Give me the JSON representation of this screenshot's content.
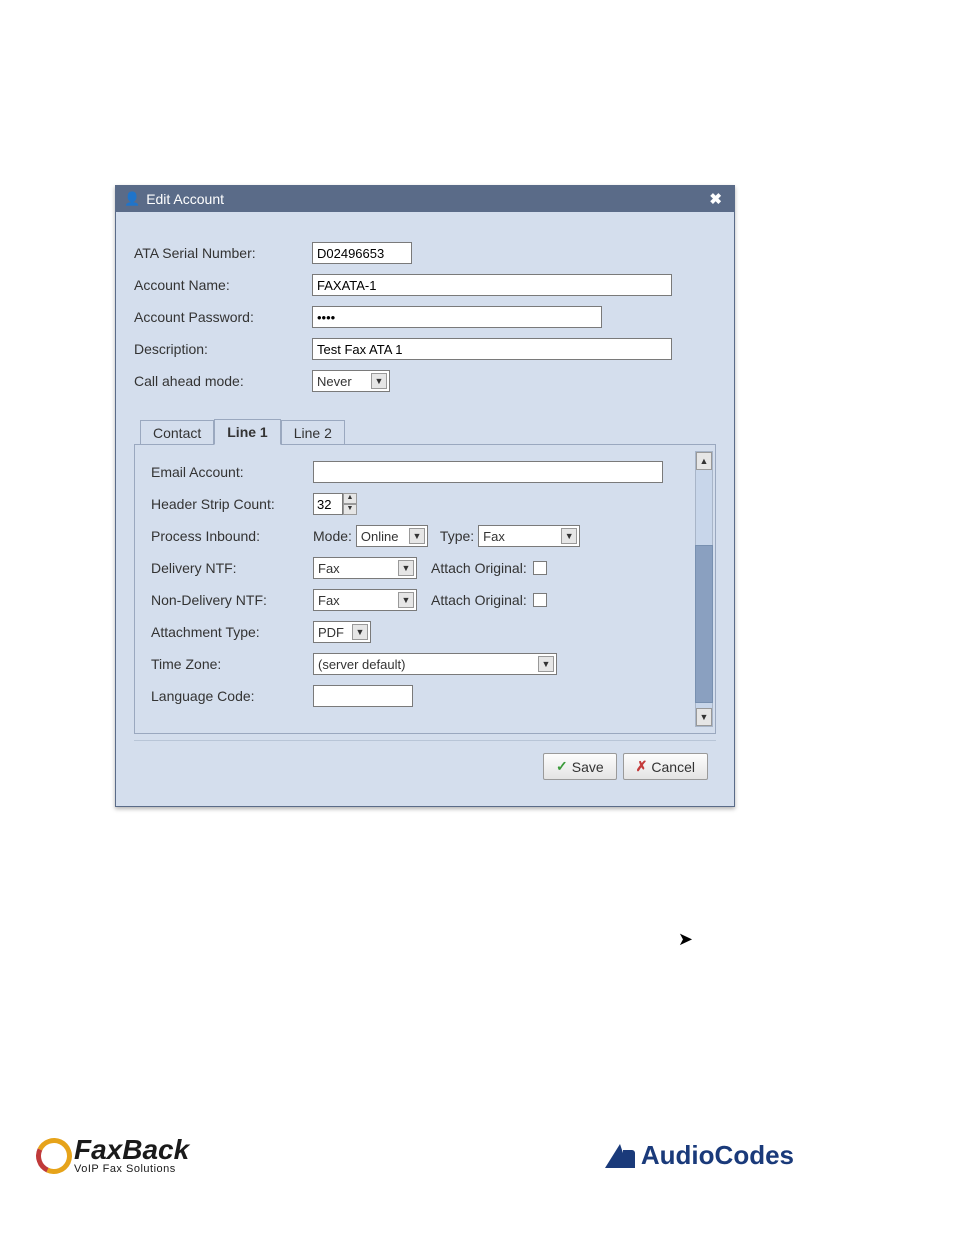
{
  "dialog": {
    "title": "Edit Account"
  },
  "fields": {
    "ata_serial_label": "ATA Serial Number:",
    "ata_serial_value": "D02496653",
    "account_name_label": "Account Name:",
    "account_name_value": "FAXATA-1",
    "account_pw_label": "Account Password:",
    "account_pw_value": "••••",
    "description_label": "Description:",
    "description_value": "Test Fax ATA 1",
    "call_ahead_label": "Call ahead mode:",
    "call_ahead_value": "Never"
  },
  "tabs": {
    "contact": "Contact",
    "line1": "Line 1",
    "line2": "Line 2"
  },
  "line1": {
    "email_label": "Email Account:",
    "email_value": "",
    "header_strip_label": "Header Strip Count:",
    "header_strip_value": "32",
    "process_inbound_label": "Process Inbound:",
    "mode_label": "Mode:",
    "mode_value": "Online",
    "type_label": "Type:",
    "type_value": "Fax",
    "delivery_ntf_label": "Delivery NTF:",
    "delivery_ntf_value": "Fax",
    "attach_original_label": "Attach Original:",
    "nondelivery_ntf_label": "Non-Delivery NTF:",
    "nondelivery_ntf_value": "Fax",
    "attachment_type_label": "Attachment Type:",
    "attachment_type_value": "PDF",
    "time_zone_label": "Time Zone:",
    "time_zone_value": "(server default)",
    "language_code_label": "Language Code:",
    "language_code_value": ""
  },
  "buttons": {
    "save": "Save",
    "cancel": "Cancel"
  },
  "footer": {
    "faxback": "FaxBack",
    "faxback_sub": "VoIP Fax Solutions",
    "audiocodes": "AudioCodes"
  }
}
